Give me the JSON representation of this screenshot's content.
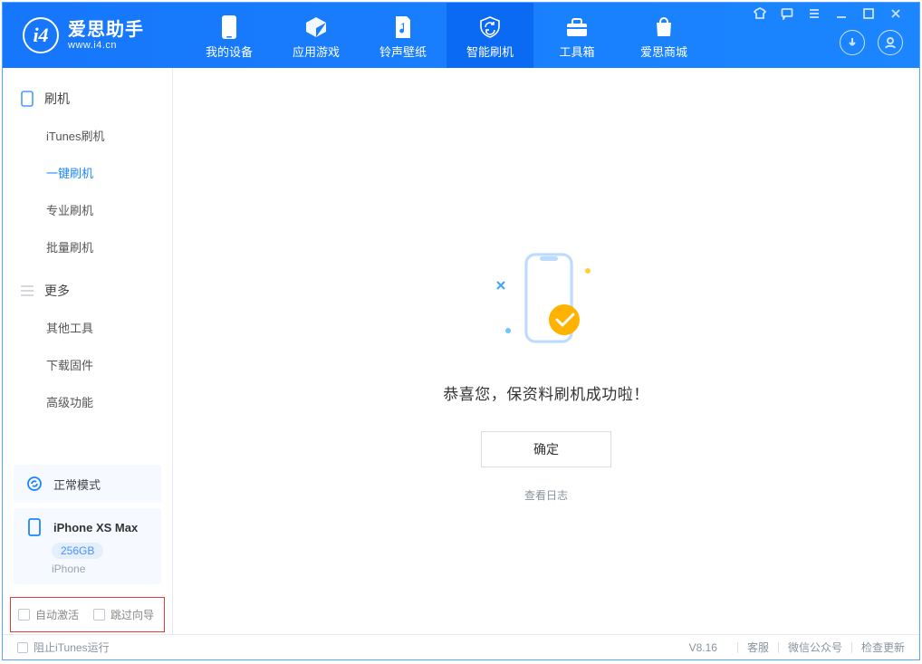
{
  "brand": {
    "name": "爱思助手",
    "url": "www.i4.cn"
  },
  "tabs": [
    {
      "label": "我的设备"
    },
    {
      "label": "应用游戏"
    },
    {
      "label": "铃声壁纸"
    },
    {
      "label": "智能刷机"
    },
    {
      "label": "工具箱"
    },
    {
      "label": "爱思商城"
    }
  ],
  "sidebar": {
    "section1_title": "刷机",
    "section1_items": [
      {
        "label": "iTunes刷机"
      },
      {
        "label": "一键刷机"
      },
      {
        "label": "专业刷机"
      },
      {
        "label": "批量刷机"
      }
    ],
    "section2_title": "更多",
    "section2_items": [
      {
        "label": "其他工具"
      },
      {
        "label": "下载固件"
      },
      {
        "label": "高级功能"
      }
    ]
  },
  "mode_card": {
    "text": "正常模式"
  },
  "device": {
    "name": "iPhone XS Max",
    "capacity": "256GB",
    "kind": "iPhone"
  },
  "options": {
    "auto_activate": "自动激活",
    "skip_guide": "跳过向导"
  },
  "main": {
    "message": "恭喜您，保资料刷机成功啦！",
    "confirm": "确定",
    "log_link": "查看日志"
  },
  "footer": {
    "block_itunes": "阻止iTunes运行",
    "version": "V8.16",
    "links": [
      {
        "label": "客服"
      },
      {
        "label": "微信公众号"
      },
      {
        "label": "检查更新"
      }
    ]
  }
}
